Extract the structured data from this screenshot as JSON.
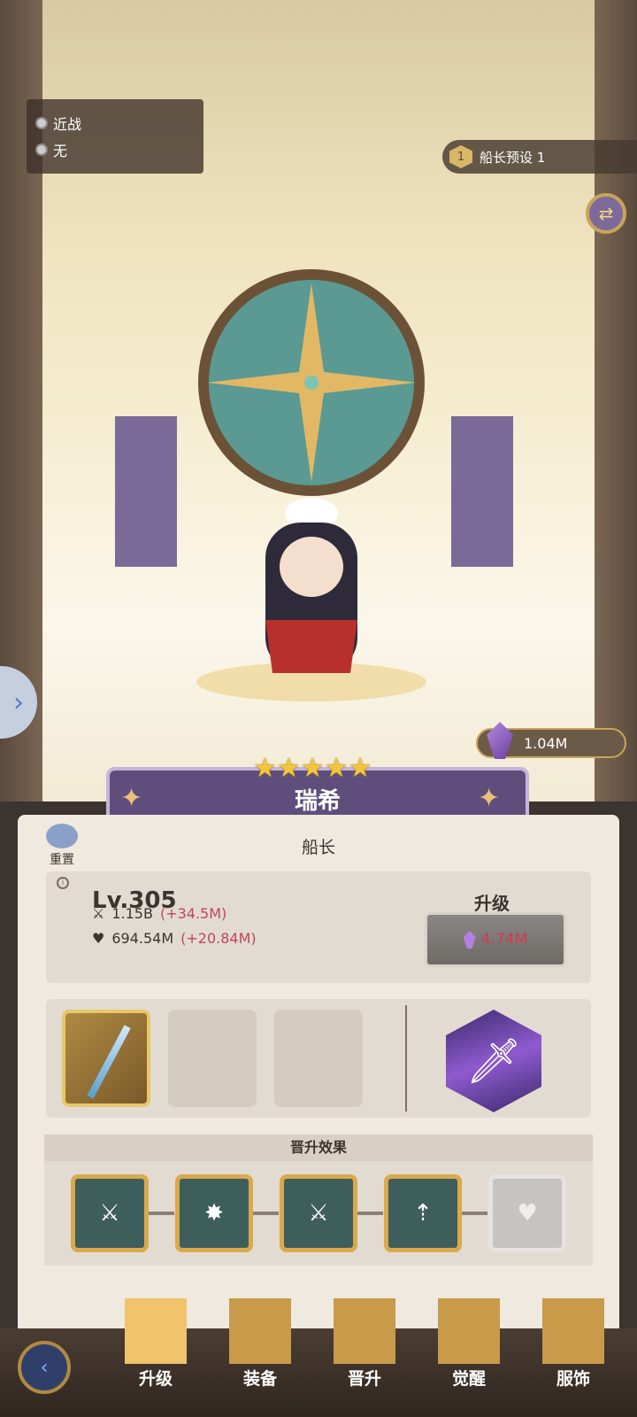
{
  "top_left_info": {
    "attack_type": "近战",
    "element": "无"
  },
  "preset": {
    "number": "1",
    "label": "船长预设 1"
  },
  "currency": {
    "amount": "1.04M"
  },
  "hero": {
    "stars": "★★★★★",
    "name": "瑞希",
    "class": "船长"
  },
  "reset": {
    "label": "重置"
  },
  "stats": {
    "level": "Lv.305",
    "attack": "1.15B",
    "attack_bonus": "(+34.5M)",
    "hp": "694.54M",
    "hp_bonus": "(+20.84M)"
  },
  "upgrade": {
    "title": "升级",
    "cost": "4.74M"
  },
  "promotion": {
    "title": "晋升效果"
  },
  "nav": {
    "items": [
      "升级",
      "装备",
      "晋升",
      "觉醒",
      "服饰"
    ]
  }
}
